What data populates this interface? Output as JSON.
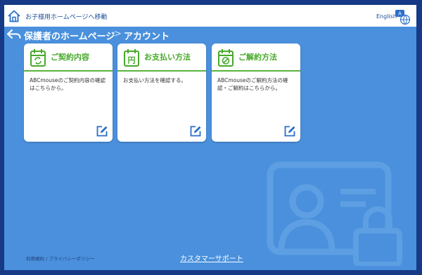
{
  "header": {
    "home_link": "お子様用ホームページへ移動",
    "language": "English",
    "home_icon": "house-icon",
    "language_icon": "language-switch-icon"
  },
  "breadcrumb": {
    "parent": "保護者のホームページ",
    "separator": ">",
    "current": "アカウント",
    "back_icon": "back-arrow-icon"
  },
  "cards": [
    {
      "title": "ご契約内容",
      "description": "ABCmouseのご契約内容の確認はこちらから。",
      "icon": "calendar-refresh-icon"
    },
    {
      "title": "お支払い方法",
      "description": "お支払い方法を確認する。",
      "icon": "yen-receipt-icon"
    },
    {
      "title": "ご解約方法",
      "description": "ABCmouseのご解約方法の確認・ご解約はこちらから。",
      "icon": "calendar-cancel-icon"
    }
  ],
  "footer": {
    "links": "利用規約 / プライバシーポリシー",
    "support": "カスタマーサポート"
  },
  "colors": {
    "background": "#4a90dc",
    "accent_green": "#48a92b",
    "link_blue": "#1d4f99"
  }
}
